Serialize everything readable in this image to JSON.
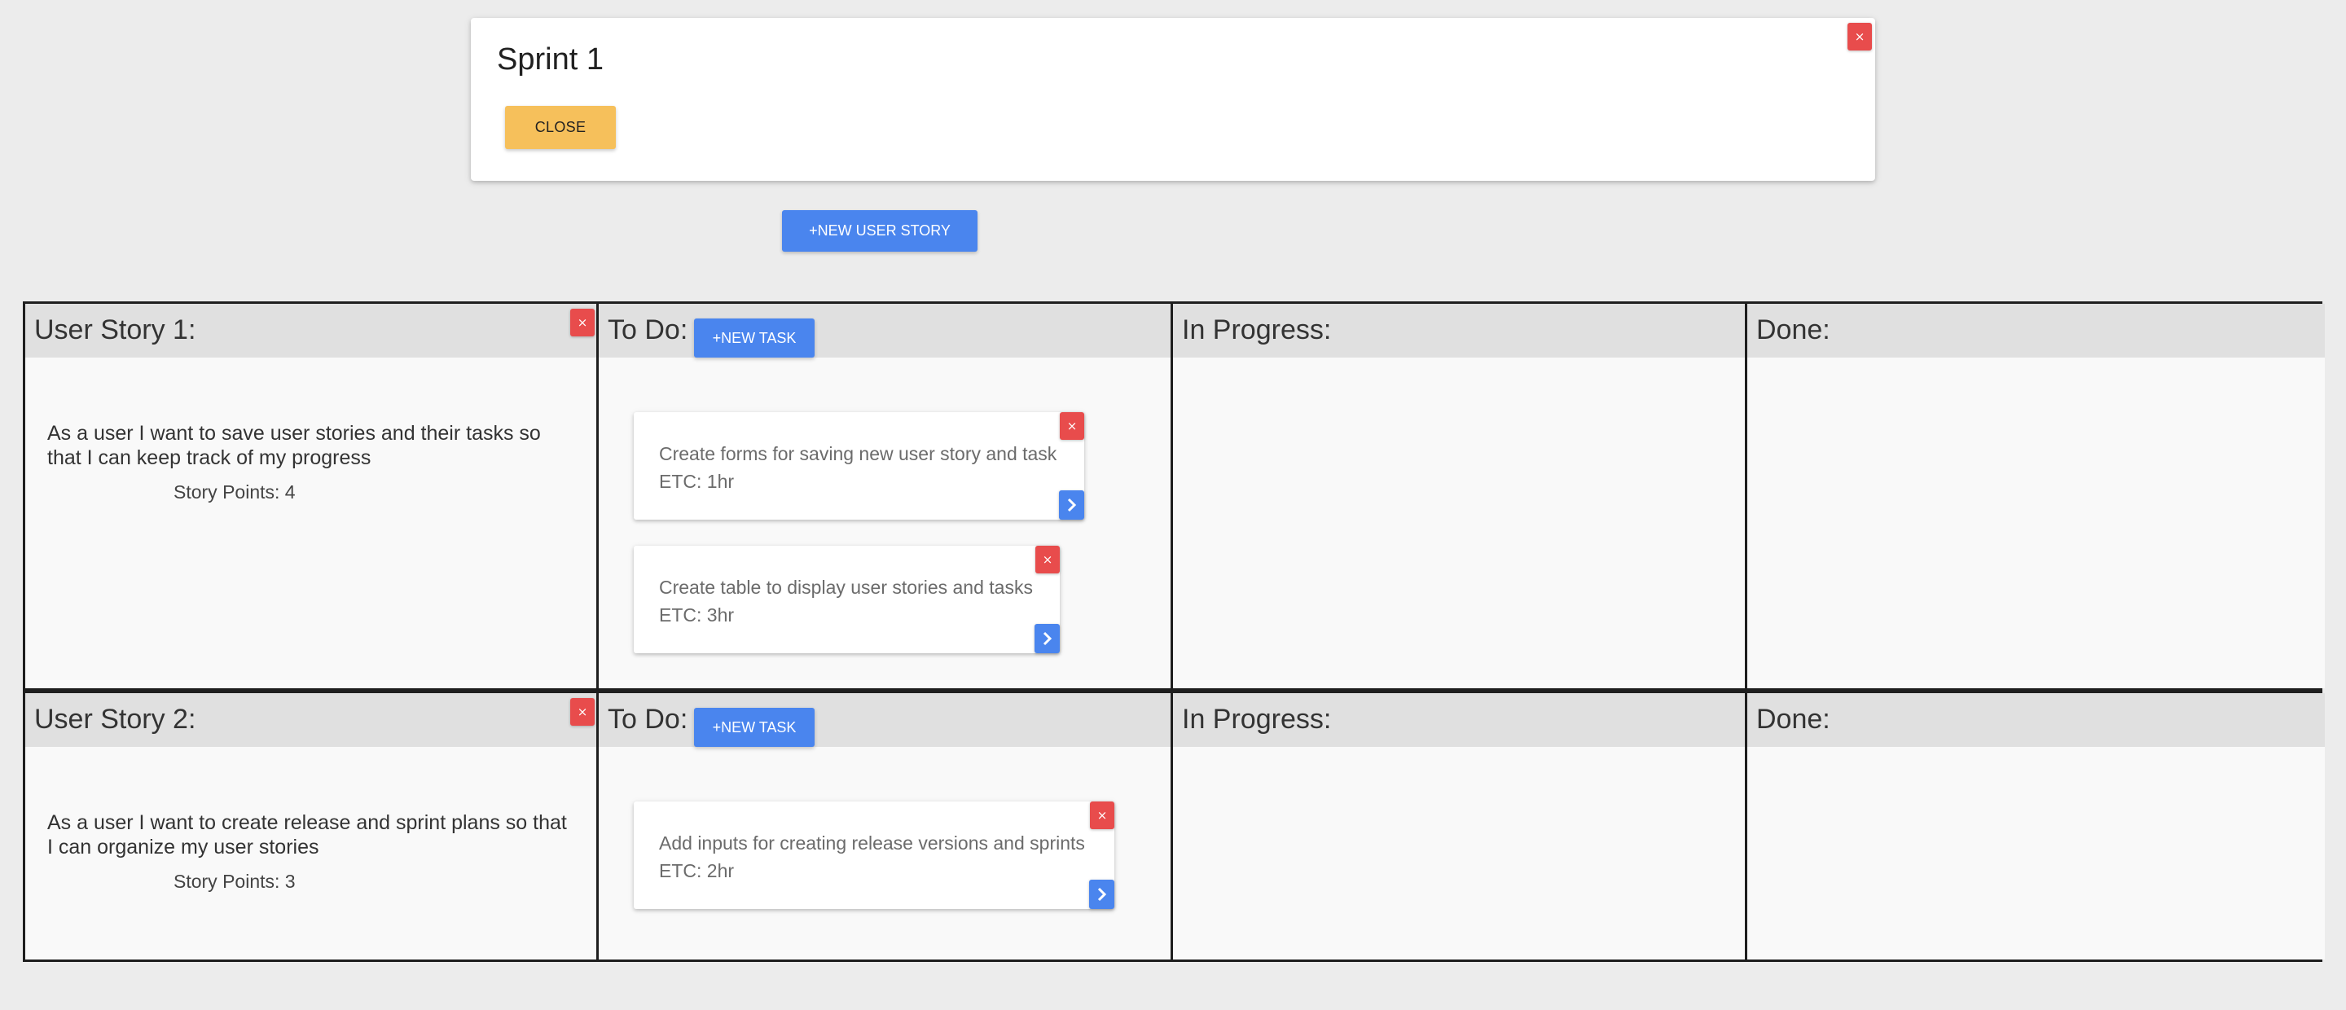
{
  "sprint": {
    "title": "Sprint 1",
    "close_label": "CLOSE",
    "remove_label": "×"
  },
  "new_story_label": "+NEW USER STORY",
  "columns": {
    "todo": "To Do:",
    "in_progress": "In Progress:",
    "done": "Done:"
  },
  "new_task_label": "+NEW TASK",
  "remove_label": "×",
  "stories": [
    {
      "title": "User Story 1:",
      "description": "As a user I want to save user stories and their tasks so that I can keep track of my progress",
      "points": "Story Points: 4",
      "tasks": [
        {
          "name": "Create forms for saving new user story and task",
          "etc": "ETC: 1hr"
        },
        {
          "name": "Create table to display user stories and tasks",
          "etc": "ETC: 3hr"
        }
      ]
    },
    {
      "title": "User Story 2:",
      "description": "As a user I want to create release and sprint plans so that I can organize my user stories",
      "points": "Story Points: 3",
      "tasks": [
        {
          "name": "Add inputs for creating release versions and sprints",
          "etc": "ETC: 2hr"
        }
      ]
    }
  ],
  "colors": {
    "primary": "#4a85ee",
    "danger": "#e84c4c",
    "warning": "#f6c05b",
    "header_bg": "#e0e0e0",
    "page_bg": "#ececec"
  }
}
